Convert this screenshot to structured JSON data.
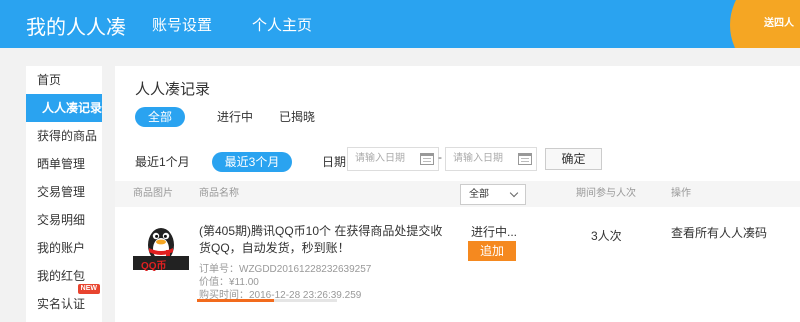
{
  "header": {
    "logo": "我的人人凑",
    "nav": [
      "账号设置",
      "个人主页"
    ],
    "corner_text": "送四人"
  },
  "sidebar": {
    "items": [
      {
        "label": "首页",
        "active": false
      },
      {
        "label": "人人凑记录",
        "active": true
      },
      {
        "label": "获得的商品",
        "active": false
      },
      {
        "label": "晒单管理",
        "active": false
      },
      {
        "label": "交易管理",
        "active": false
      },
      {
        "label": "交易明细",
        "active": false
      },
      {
        "label": "我的账户",
        "active": false
      },
      {
        "label": "我的红包",
        "active": false
      },
      {
        "label": "实名认证",
        "active": false,
        "badge": "NEW"
      }
    ]
  },
  "main": {
    "title": "人人凑记录",
    "tabs": [
      {
        "label": "全部",
        "active": true
      },
      {
        "label": "进行中",
        "active": false
      },
      {
        "label": "已揭晓",
        "active": false
      }
    ],
    "filters": {
      "ranges": [
        {
          "label": "最近1个月",
          "active": false
        },
        {
          "label": "最近3个月",
          "active": true
        }
      ],
      "date_label": "日期",
      "start_placeholder": "请输入日期",
      "end_placeholder": "请输入日期",
      "separator": "-",
      "confirm_label": "确定"
    },
    "table": {
      "headers": {
        "image": "商品图片",
        "name": "商品名称",
        "status_select": "全部",
        "period": "期间参与人次",
        "action": "操作"
      },
      "rows": [
        {
          "image_label": "QQ币",
          "title": "(第405期)腾讯QQ币10个 在获得商品处提交收货QQ，自动发货，秒到账！",
          "order": "订单号：WZGDD20161228232639257",
          "price": "价值：¥11.00",
          "purchase_time": "购买时间：2016-12-28 23:26:39.259",
          "progress": 0.55,
          "status": "进行中...",
          "action_button": "追加",
          "participants": "3人次",
          "view_codes": "查看所有人人凑码"
        }
      ]
    }
  },
  "colors": {
    "primary": "#2aa3f0",
    "accent": "#f5891f",
    "corner": "#f5a623",
    "badge": "#e8442f"
  }
}
